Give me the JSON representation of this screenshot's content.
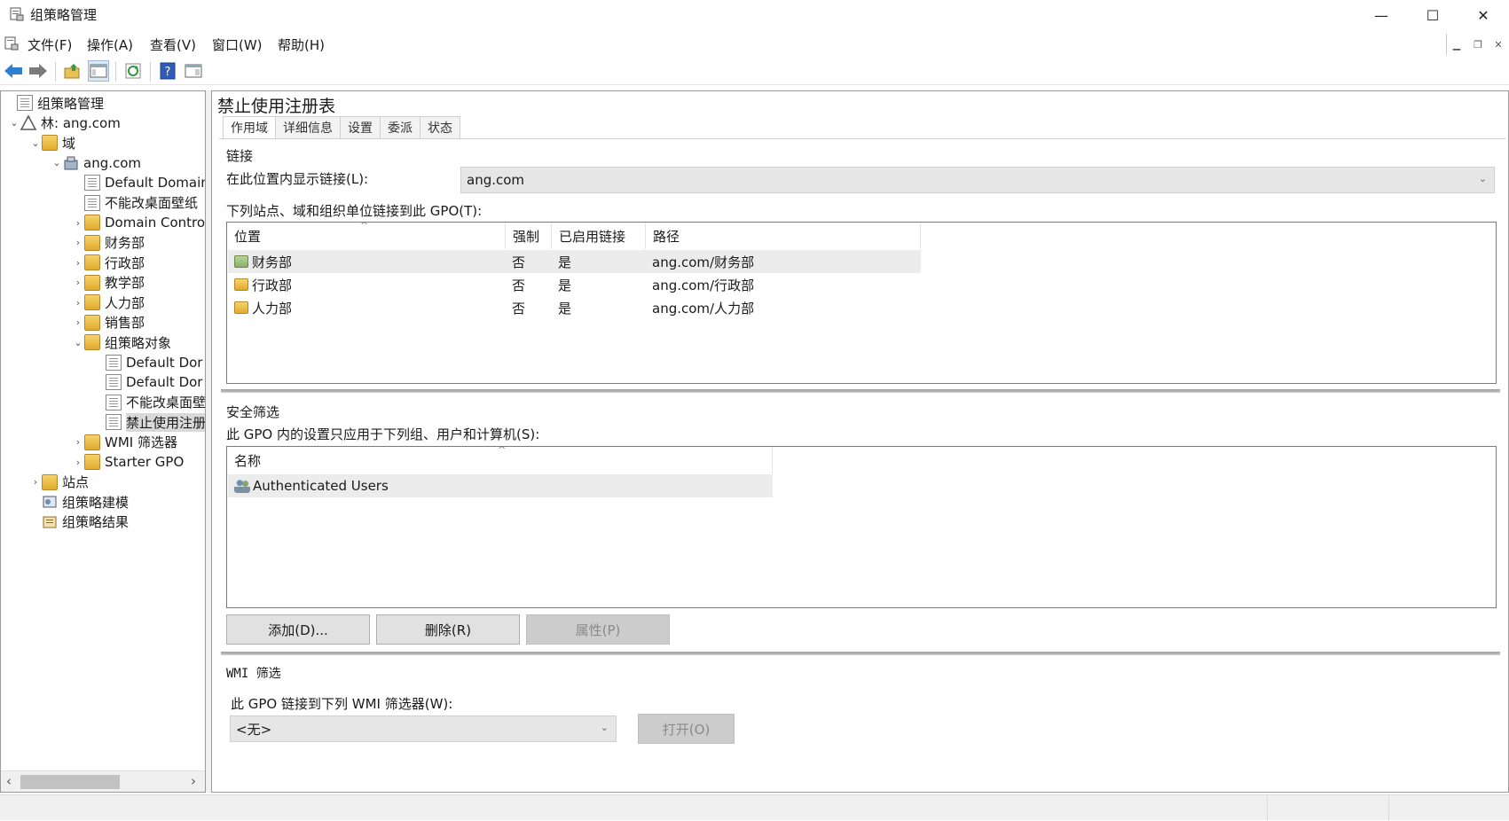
{
  "window": {
    "title": "组策略管理",
    "controls": {
      "minimize": "—",
      "maximize": "☐",
      "close": "✕"
    }
  },
  "menubar": {
    "items": [
      "文件(F)",
      "操作(A)",
      "查看(V)",
      "窗口(W)",
      "帮助(H)"
    ]
  },
  "toolbar": {
    "icons": [
      "back-arrow-icon",
      "forward-arrow-icon",
      "up-folder-icon",
      "show-hide-console-tree-icon",
      "refresh-icon",
      "help-icon",
      "action-pane-icon"
    ],
    "help_glyph": "?"
  },
  "tree": {
    "items": [
      {
        "label": "组策略管理",
        "level": 0,
        "expander": "",
        "icon": "gpm-icon"
      },
      {
        "label": "林: ang.com",
        "level": 1,
        "expander": "⌄",
        "icon": "forest-icon"
      },
      {
        "label": "域",
        "level": 2,
        "expander": "⌄",
        "icon": "domains-icon"
      },
      {
        "label": "ang.com",
        "level": 3,
        "expander": "⌄",
        "icon": "domain-icon"
      },
      {
        "label": "Default Domain",
        "level": 4,
        "expander": "",
        "icon": "gpo-link-icon"
      },
      {
        "label": "不能改桌面壁纸",
        "level": 4,
        "expander": "",
        "icon": "gpo-link-icon"
      },
      {
        "label": "Domain Contro",
        "level": 4,
        "expander": "›",
        "icon": "ou-folder-icon"
      },
      {
        "label": "财务部",
        "level": 4,
        "expander": "›",
        "icon": "ou-folder-icon"
      },
      {
        "label": "行政部",
        "level": 4,
        "expander": "›",
        "icon": "ou-folder-icon"
      },
      {
        "label": "教学部",
        "level": 4,
        "expander": "›",
        "icon": "ou-folder-icon"
      },
      {
        "label": "人力部",
        "level": 4,
        "expander": "›",
        "icon": "ou-folder-icon"
      },
      {
        "label": "销售部",
        "level": 4,
        "expander": "›",
        "icon": "ou-folder-icon"
      },
      {
        "label": "组策略对象",
        "level": 4,
        "expander": "⌄",
        "icon": "gpo-container-icon"
      },
      {
        "label": "Default Dor",
        "level": 5,
        "expander": "",
        "icon": "gpo-icon"
      },
      {
        "label": "Default Dor",
        "level": 5,
        "expander": "",
        "icon": "gpo-icon"
      },
      {
        "label": "不能改桌面壁",
        "level": 5,
        "expander": "",
        "icon": "gpo-icon"
      },
      {
        "label": "禁止使用注册",
        "level": 5,
        "expander": "",
        "icon": "gpo-icon",
        "selected": true
      },
      {
        "label": "WMI 筛选器",
        "level": 4,
        "expander": "›",
        "icon": "wmi-filter-icon"
      },
      {
        "label": "Starter GPO",
        "level": 4,
        "expander": "›",
        "icon": "starter-gpo-icon"
      },
      {
        "label": "站点",
        "level": 1,
        "expander": "›",
        "icon": "sites-icon"
      },
      {
        "label": "组策略建模",
        "level": 1,
        "expander": "",
        "icon": "modeling-icon"
      },
      {
        "label": "组策略结果",
        "level": 1,
        "expander": "",
        "icon": "results-icon"
      }
    ],
    "scroll_left": "‹",
    "scroll_right": "›"
  },
  "details": {
    "title": "禁止使用注册表",
    "tabs": [
      "作用域",
      "详细信息",
      "设置",
      "委派",
      "状态"
    ],
    "links_section": {
      "heading": "链接",
      "location_label": "在此位置内显示链接(L):",
      "location_value": "ang.com",
      "list_label": "下列站点、域和组织单位链接到此 GPO(T):",
      "columns": [
        "位置",
        "强制",
        "已启用链接",
        "路径"
      ],
      "rows": [
        {
          "location": "财务部",
          "enforced": "否",
          "enabled": "是",
          "path": "ang.com/财务部",
          "selected": true
        },
        {
          "location": "行政部",
          "enforced": "否",
          "enabled": "是",
          "path": "ang.com/行政部"
        },
        {
          "location": "人力部",
          "enforced": "否",
          "enabled": "是",
          "path": "ang.com/人力部"
        }
      ]
    },
    "security_section": {
      "heading": "安全筛选",
      "description": "此 GPO 内的设置只应用于下列组、用户和计算机(S):",
      "column": "名称",
      "rows": [
        "Authenticated Users"
      ],
      "add_button": "添加(D)...",
      "remove_button": "删除(R)",
      "properties_button": "属性(P)"
    },
    "wmi_section": {
      "heading": "WMI 筛选",
      "description": "此 GPO 链接到下列 WMI 筛选器(W):",
      "filter_value": "<无>",
      "open_button": "打开(O)"
    },
    "sort_caret": "^",
    "dropdown_arrow": "⌄"
  }
}
